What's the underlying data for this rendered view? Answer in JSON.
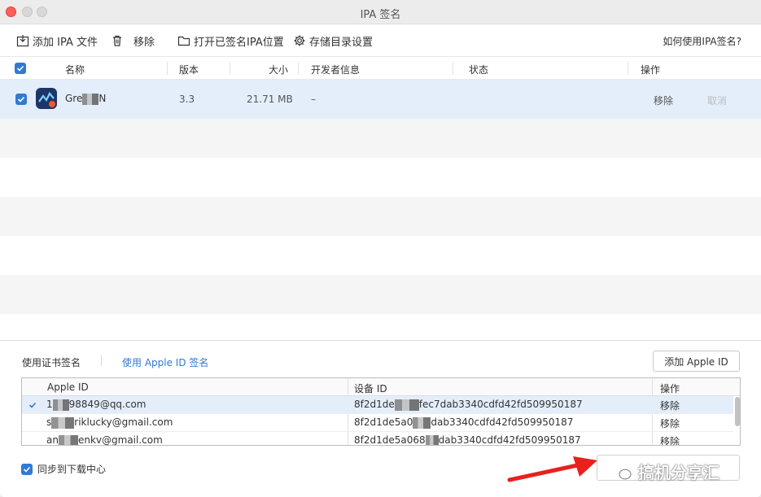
{
  "window": {
    "title": "IPA 签名"
  },
  "toolbar": {
    "add_ipa": "添加 IPA 文件",
    "remove": "移除",
    "open_signed": "打开已签名IPA位置",
    "storage_settings": "存储目录设置",
    "help": "如何使用IPA签名?"
  },
  "table": {
    "headers": {
      "name": "名称",
      "version": "版本",
      "size": "大小",
      "developer": "开发者信息",
      "status": "状态",
      "actions": "操作"
    },
    "rows": [
      {
        "name": "Gre",
        "name_suffix": "N",
        "version": "3.3",
        "size": "21.71 MB",
        "developer": "–",
        "status": "",
        "remove": "移除",
        "cancel": "取消"
      }
    ]
  },
  "sign": {
    "tab_cert": "使用证书签名",
    "tab_apple_id": "使用 Apple ID 签名",
    "add_apple_id": "添加 Apple ID"
  },
  "apple_ids": {
    "headers": {
      "apple_id": "Apple ID",
      "device_id": "设备 ID",
      "action": "操作"
    },
    "rows": [
      {
        "apple_id_a": "1",
        "apple_id_b": "98849@qq.com",
        "device_a": "8f2d1de",
        "device_b": "fec7dab3340cdfd42fd509950187",
        "action": "移除"
      },
      {
        "apple_id_a": "s",
        "apple_id_b": "riklucky@gmail.com",
        "device_a": "8f2d1de5a0",
        "device_b": "dab3340cdfd42fd509950187",
        "action": "移除"
      },
      {
        "apple_id_a": "an",
        "apple_id_b": "enkv@gmail.com",
        "device_a": "8f2d1de5a068",
        "device_b": "dab3340cdfd42fd509950187",
        "action": "移除"
      }
    ]
  },
  "footer": {
    "sync": "同步到下载中心"
  },
  "watermark": "搞机分享汇",
  "colors": {
    "accent": "#2f7ad6",
    "selected_row": "#e4eefb",
    "close": "#ff5f57",
    "arrow": "#e8211d"
  }
}
